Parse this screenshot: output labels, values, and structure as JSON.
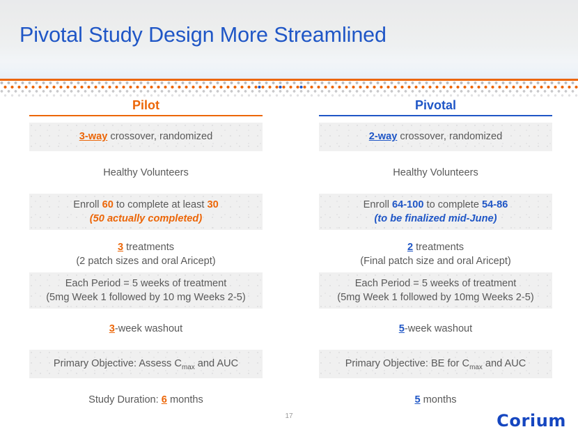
{
  "slide": {
    "title": "Pivotal Study Design More Streamlined",
    "page_number": "17",
    "logo": "Corium",
    "accent_orange": "#ec6608",
    "accent_blue": "#1f56c6",
    "text_gray": "#595959",
    "shaded_row_bg": "#f0f0f0"
  },
  "columns": {
    "left": {
      "heading": "Pilot"
    },
    "right": {
      "heading": "Pivotal"
    }
  },
  "rows": [
    {
      "id": "crossover",
      "shaded": true,
      "left": {
        "accent": "3-way",
        "rest": " crossover, randomized"
      },
      "right": {
        "accent": "2-way",
        "rest": " crossover, randomized"
      }
    },
    {
      "id": "population",
      "shaded": false,
      "left": {
        "line1": "Healthy Volunteers"
      },
      "right": {
        "line1": "Healthy Volunteers"
      }
    },
    {
      "id": "enrollment",
      "shaded": true,
      "left": {
        "pre": "Enroll ",
        "n1": "60",
        "mid": " to complete at least ",
        "n2": "30",
        "note": "(50 actually completed)"
      },
      "right": {
        "pre": "Enroll ",
        "n1": "64-100",
        "mid": " to complete ",
        "n2": "54-86",
        "note": "(to be finalized mid-June)"
      }
    },
    {
      "id": "treatments",
      "shaded": false,
      "left": {
        "accent": "3",
        "rest": " treatments",
        "line2": "(2 patch sizes and oral Aricept)"
      },
      "right": {
        "accent": "2",
        "rest": " treatments",
        "line2": "(Final patch size and oral Aricept)"
      }
    },
    {
      "id": "period",
      "shaded": true,
      "left": {
        "line1": "Each Period = 5 weeks of treatment",
        "line2": "(5mg Week 1 followed by 10 mg Weeks 2-5)"
      },
      "right": {
        "line1": "Each Period = 5 weeks of treatment",
        "line2": "(5mg Week 1 followed by 10mg Weeks 2-5)"
      }
    },
    {
      "id": "washout",
      "shaded": false,
      "left": {
        "accent": "3",
        "rest": "-week washout"
      },
      "right": {
        "accent": "5",
        "rest": "-week washout"
      }
    },
    {
      "id": "objective",
      "shaded": true,
      "left": {
        "pre": "Primary Objective: Assess C",
        "sub": "max",
        "post": " and AUC"
      },
      "right": {
        "pre": "Primary Objective: BE for C",
        "sub": "max",
        "post": " and AUC"
      }
    },
    {
      "id": "duration",
      "shaded": false,
      "left": {
        "pre": "Study Duration: ",
        "accent": "6",
        "rest": " months"
      },
      "right": {
        "accent": "5",
        "rest": " months"
      }
    }
  ]
}
